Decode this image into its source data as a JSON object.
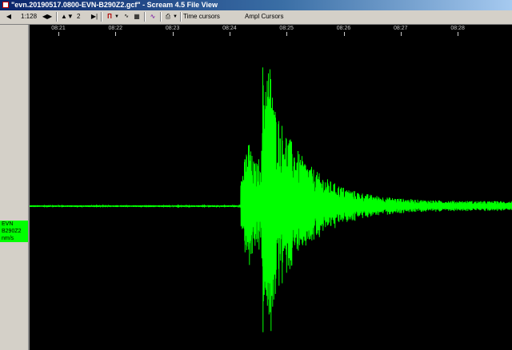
{
  "window": {
    "title": "\"evn.20190517.0800-EVN-B290Z2.gcf\" - Scream 4.5 File View"
  },
  "toolbar": {
    "scale": "1:128",
    "gain": "2",
    "time_cursors": "Time cursors",
    "ampl_cursors": "Ampl Cursors"
  },
  "channel": {
    "station": "EVN",
    "stream": "B290Z2",
    "units": "nm/s"
  },
  "time_axis": {
    "ticks": [
      "08:21",
      "08:22",
      "08:23",
      "08:24",
      "08:25",
      "08:26",
      "08:27",
      "08:28"
    ]
  },
  "trace": {
    "color": "#00ff00",
    "background": "#000000",
    "event_onset_time": "08:24:15",
    "peak_time": "08:24:45"
  }
}
